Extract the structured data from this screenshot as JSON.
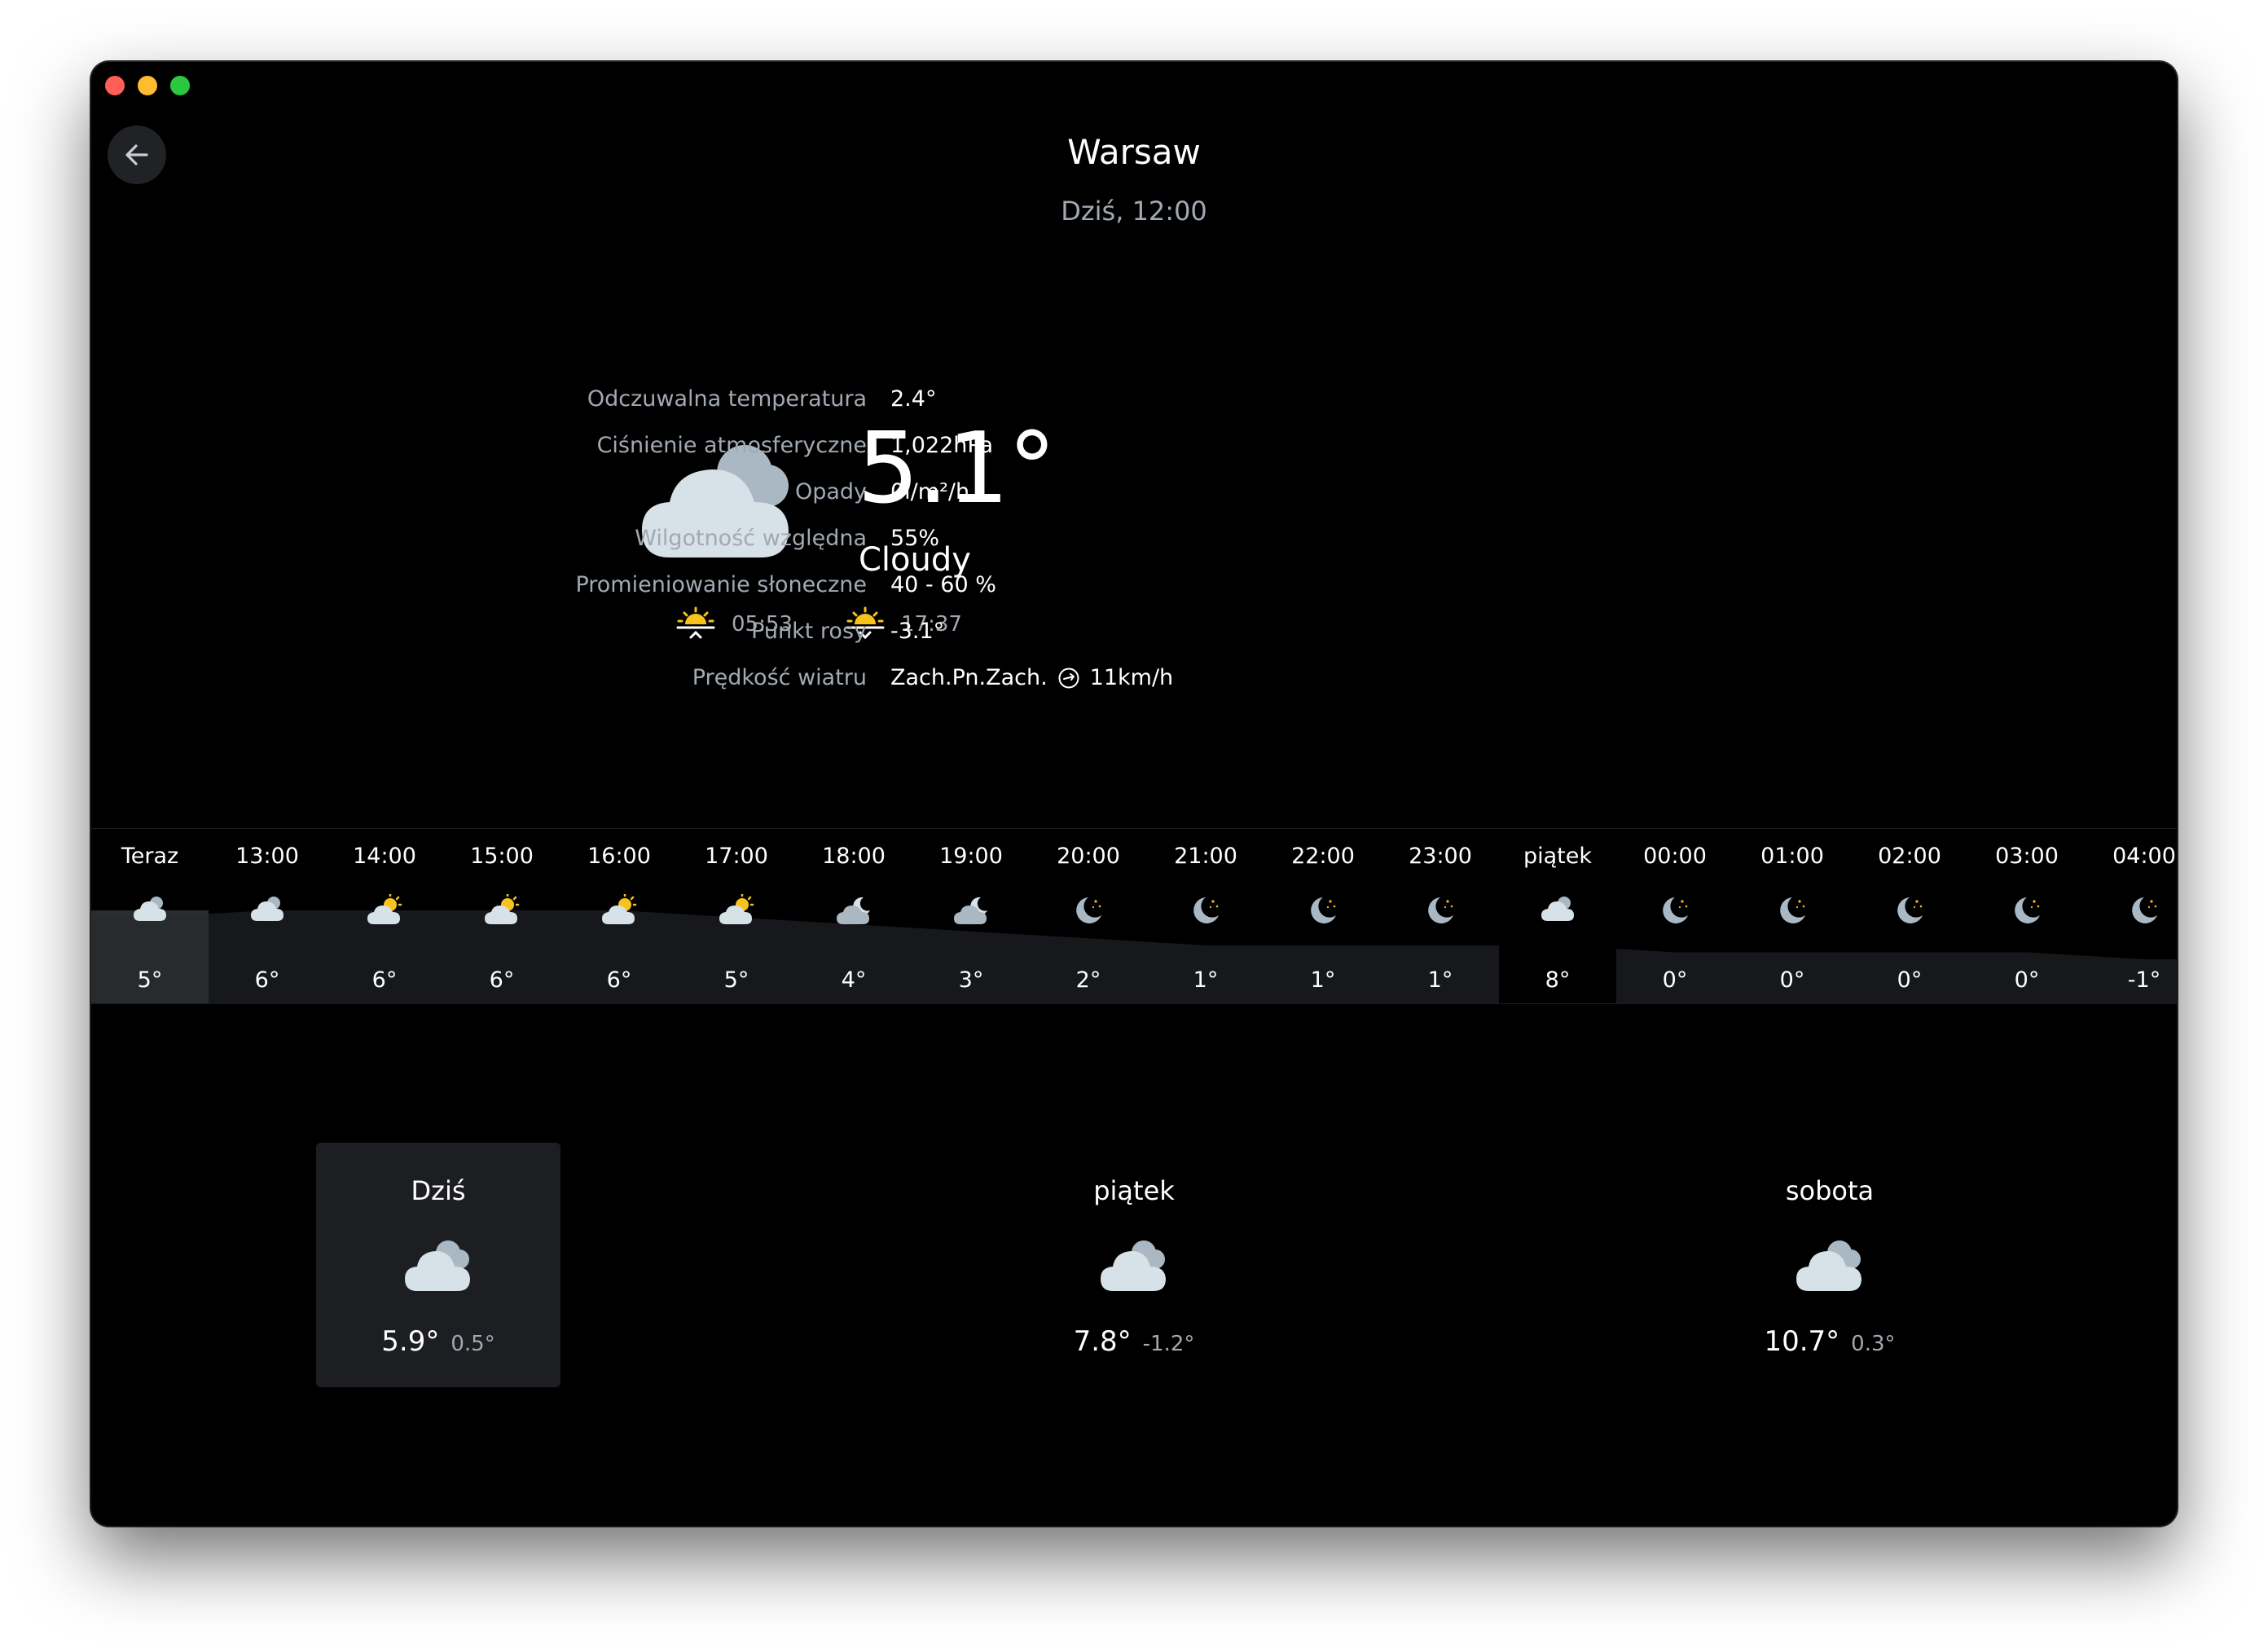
{
  "header": {
    "city": "Warsaw",
    "datetime": "Dziś, 12:00"
  },
  "current": {
    "temperature": "5.1°",
    "condition": "Cloudy",
    "icon": "cloudy-icon",
    "sunrise": "05:53",
    "sunset": "17:37"
  },
  "details": [
    {
      "label": "Odczuwalna temperatura",
      "value": "2.4°"
    },
    {
      "label": "Ciśnienie atmosferyczne",
      "value": "1,022hPa"
    },
    {
      "label": "Opady",
      "value": "0l/m²/h"
    },
    {
      "label": "Wilgotność względna",
      "value": "55%"
    },
    {
      "label": "Promieniowanie słoneczne",
      "value": "40 - 60 %"
    },
    {
      "label": "Punkt rosy",
      "value": "-3.1°"
    },
    {
      "label": "Prędkość wiatru",
      "value_dir": "Zach.Pn.Zach.",
      "value_speed": "11km/h",
      "icon": "wind-direction-icon"
    }
  ],
  "hourly": [
    {
      "label": "Teraz",
      "temp": "5°",
      "t": 5,
      "icon": "cloud-icon"
    },
    {
      "label": "13:00",
      "temp": "6°",
      "t": 6,
      "icon": "cloud-icon"
    },
    {
      "label": "14:00",
      "temp": "6°",
      "t": 6,
      "icon": "sun-cloud-icon"
    },
    {
      "label": "15:00",
      "temp": "6°",
      "t": 6,
      "icon": "sun-cloud-icon"
    },
    {
      "label": "16:00",
      "temp": "6°",
      "t": 6,
      "icon": "sun-cloud-icon"
    },
    {
      "label": "17:00",
      "temp": "5°",
      "t": 5,
      "icon": "sun-cloud-icon"
    },
    {
      "label": "18:00",
      "temp": "4°",
      "t": 4,
      "icon": "moon-cloud-icon"
    },
    {
      "label": "19:00",
      "temp": "3°",
      "t": 3,
      "icon": "moon-cloud-icon"
    },
    {
      "label": "20:00",
      "temp": "2°",
      "t": 2,
      "icon": "moon-icon"
    },
    {
      "label": "21:00",
      "temp": "1°",
      "t": 1,
      "icon": "moon-icon"
    },
    {
      "label": "22:00",
      "temp": "1°",
      "t": 1,
      "icon": "moon-icon"
    },
    {
      "label": "23:00",
      "temp": "1°",
      "t": 1,
      "icon": "moon-icon"
    },
    {
      "label": "piątek",
      "temp": "8°",
      "t": 8,
      "icon": "cloud-icon"
    },
    {
      "label": "00:00",
      "temp": "0°",
      "t": 0,
      "icon": "moon-icon"
    },
    {
      "label": "01:00",
      "temp": "0°",
      "t": 0,
      "icon": "moon-icon"
    },
    {
      "label": "02:00",
      "temp": "0°",
      "t": 0,
      "icon": "moon-icon"
    },
    {
      "label": "03:00",
      "temp": "0°",
      "t": 0,
      "icon": "moon-icon"
    },
    {
      "label": "04:00",
      "temp": "-1°",
      "t": -1,
      "icon": "moon-icon"
    }
  ],
  "daily": [
    {
      "day": "Dziś",
      "max": "5.9°",
      "min": "0.5°",
      "selected": true,
      "icon": "cloudy-icon"
    },
    {
      "day": "piątek",
      "max": "7.8°",
      "min": "-1.2°",
      "selected": false,
      "icon": "cloudy-icon"
    },
    {
      "day": "sobota",
      "max": "10.7°",
      "min": "0.3°",
      "selected": false,
      "icon": "cloudy-icon"
    }
  ],
  "colors": {
    "background": "#000000",
    "secondary_text": "#a2a9b3",
    "sun_yellow": "#f7c21b",
    "cloud_light": "#d7e1e8",
    "cloud_dark": "#a9b8c3"
  }
}
